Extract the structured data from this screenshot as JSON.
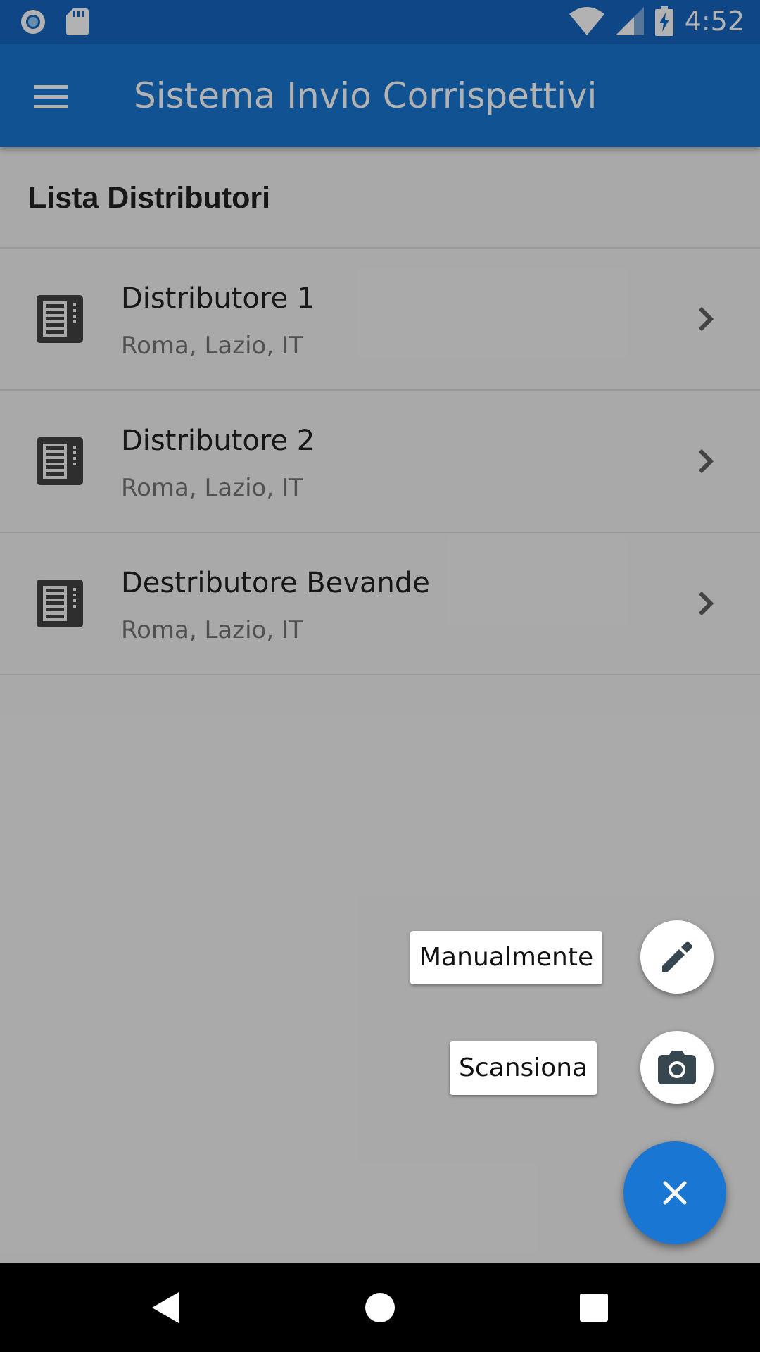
{
  "status_bar": {
    "time": "4:52",
    "icons": [
      "circle-notification-icon",
      "sd-card-icon",
      "wifi-icon",
      "cell-signal-icon",
      "battery-charging-icon"
    ]
  },
  "app_bar": {
    "title": "Sistema Invio Corrispettivi",
    "menu_icon": "menu-icon"
  },
  "list": {
    "header": "Lista Distributori",
    "items": [
      {
        "title": "Distributore 1",
        "subtitle": "Roma, Lazio, IT",
        "icon": "vending-machine-icon"
      },
      {
        "title": "Distributore 2",
        "subtitle": "Roma, Lazio, IT",
        "icon": "vending-machine-icon"
      },
      {
        "title": "Destributore Bevande",
        "subtitle": "Roma, Lazio, IT",
        "icon": "vending-machine-icon"
      }
    ]
  },
  "fab": {
    "actions": [
      {
        "label": "Manualmente",
        "icon": "pencil-icon"
      },
      {
        "label": "Scansiona",
        "icon": "camera-icon"
      }
    ],
    "main_icon": "close-icon"
  },
  "nav_bar": {
    "icons": [
      "back-icon",
      "home-icon",
      "recents-icon"
    ]
  },
  "colors": {
    "primary": "#1976d2",
    "primary_dark": "#1565c0",
    "icon_dark": "#424242"
  }
}
